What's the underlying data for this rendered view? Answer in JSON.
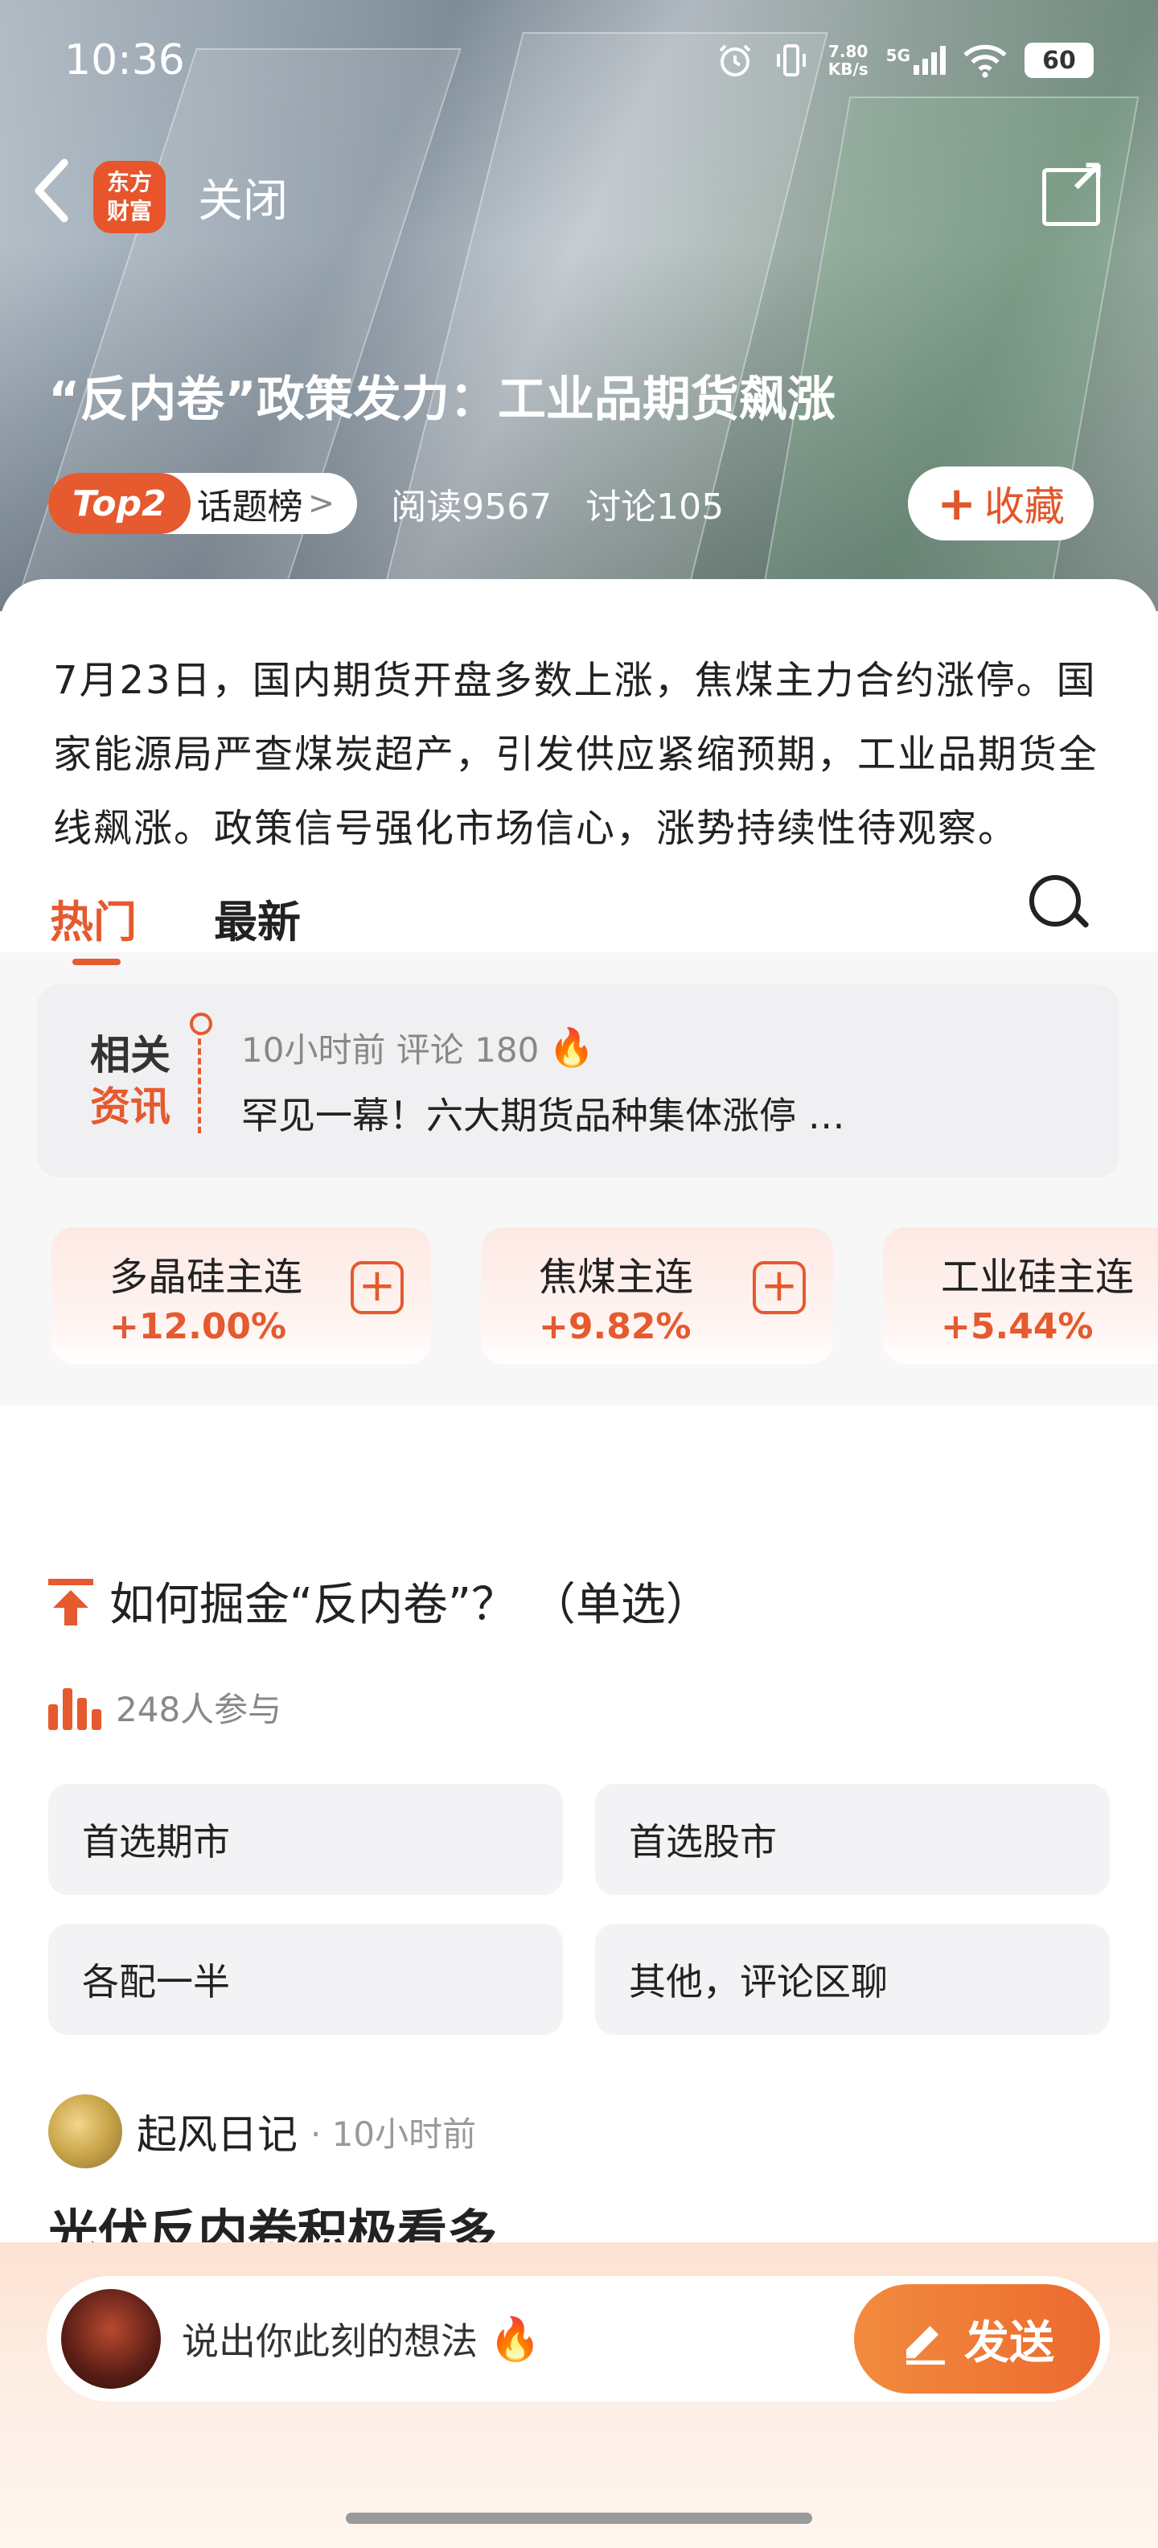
{
  "status_bar": {
    "time": "10:36",
    "net_speed_value": "7.80",
    "net_speed_unit": "KB/s",
    "network": "5G",
    "battery": "60",
    "icons": [
      "alarm-icon",
      "vibrate-icon",
      "signal-icon",
      "wifi-icon",
      "battery-icon"
    ]
  },
  "nav": {
    "back_icon": "chevron-left-icon",
    "logo_line1": "东方",
    "logo_line2": "财富",
    "close_label": "关闭",
    "share_icon": "share-external-icon"
  },
  "topic": {
    "title": "“反内卷”政策发力：工业品期货飙涨",
    "rank_tag": "Top2",
    "rank_label": "话题榜",
    "reads": "阅读9567",
    "discussions": "讨论105",
    "favorite_label": "收藏"
  },
  "summary": "7月23日，国内期货开盘多数上涨，焦煤主力合约涨停。国家能源局严查煤炭超产，引发供应紧缩预期，工业品期货全线飙涨。政策信号强化市场信心，涨势持续性待观察。",
  "related_news": {
    "badge_line1": "相关",
    "badge_line2": "资讯",
    "meta": "10小时前  评论 180",
    "headline": "罕见一幕！六大期货品种集体涨停 …"
  },
  "futures": [
    {
      "name": "多晶硅主连",
      "change": "+12.00%"
    },
    {
      "name": "焦煤主连",
      "change": "+9.82%"
    },
    {
      "name": "工业硅主连",
      "change": "+5.44%"
    }
  ],
  "tabs": [
    {
      "label": "热门",
      "active": true
    },
    {
      "label": "最新",
      "active": false
    }
  ],
  "poll": {
    "question": "如何掘金“反内卷”？ （单选）",
    "participants": "248人参与",
    "options": [
      "首选期市",
      "首选股市",
      "各配一半",
      "其他，评论区聊"
    ]
  },
  "post": {
    "author": "起风日记",
    "time": "· 10小时前",
    "title": "光伏反内卷积极看多"
  },
  "comment_bar": {
    "placeholder": "说出你此刻的想法",
    "send_label": "发送"
  },
  "colors": {
    "accent": "#e55a2e",
    "send_gradient_start": "#f28b3f",
    "send_gradient_end": "#ec6a2e"
  }
}
